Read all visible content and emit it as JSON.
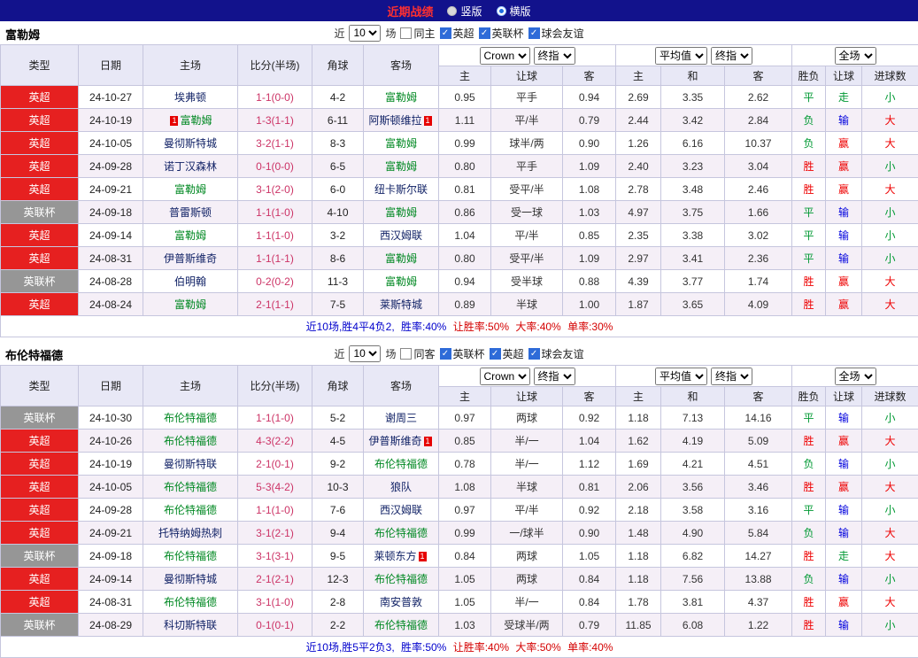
{
  "colors": {
    "topbar": "#12128c",
    "title_red": "#ff3030",
    "epl_red": "#e62020",
    "cup_gray": "#969696",
    "team_green": "#008822",
    "score_pink": "#cc3366",
    "win_red": "#ee0000",
    "lose_green": "#009933",
    "push_blue": "#0000dd"
  },
  "top_bar": {
    "title": "近期战绩",
    "vertical_label": "竖版",
    "horizontal_label": "横版"
  },
  "sections": [
    {
      "team": "富勒姆",
      "filter": {
        "prefix": "近",
        "count": "10",
        "suffix": "场",
        "checkboxes": [
          {
            "label": "同主",
            "checked": false
          },
          {
            "label": "英超",
            "checked": true
          },
          {
            "label": "英联杯",
            "checked": true
          },
          {
            "label": "球会友谊",
            "checked": true
          }
        ]
      },
      "dropdowns": {
        "odds_source": "Crown",
        "odds_time": "终指",
        "avg_source": "平均值",
        "avg_time": "终指",
        "scope": "全场"
      },
      "header": {
        "type": "类型",
        "date": "日期",
        "home": "主场",
        "score": "比分(半场)",
        "corner": "角球",
        "away": "客场",
        "odds_cols": [
          "主",
          "让球",
          "客"
        ],
        "avg_cols": [
          "主",
          "和",
          "客"
        ],
        "result_cols": [
          "胜负",
          "让球",
          "进球数"
        ]
      },
      "rows": [
        {
          "league": "英超",
          "league_class": "epl",
          "date": "24-10-27",
          "home": {
            "name": "埃弗顿",
            "main": false
          },
          "score": "1-1(0-0)",
          "corner": "4-2",
          "away": {
            "name": "富勒姆",
            "main": true
          },
          "odds": [
            "0.95",
            "平手",
            "0.94"
          ],
          "avg": [
            "2.69",
            "3.35",
            "2.62"
          ],
          "result": [
            {
              "t": "平",
              "c": "g"
            },
            {
              "t": "走",
              "c": "g"
            },
            {
              "t": "小",
              "c": "g"
            }
          ]
        },
        {
          "league": "英超",
          "league_class": "epl",
          "date": "24-10-19",
          "home": {
            "name": "富勒姆",
            "main": true,
            "card_pre": "1"
          },
          "score": "1-3(1-1)",
          "corner": "6-11",
          "away": {
            "name": "阿斯顿维拉",
            "main": false,
            "card_post": "1"
          },
          "odds": [
            "1.11",
            "平/半",
            "0.79"
          ],
          "avg": [
            "2.44",
            "3.42",
            "2.84"
          ],
          "result": [
            {
              "t": "负",
              "c": "g"
            },
            {
              "t": "输",
              "c": "b"
            },
            {
              "t": "大",
              "c": "r"
            }
          ]
        },
        {
          "league": "英超",
          "league_class": "epl",
          "date": "24-10-05",
          "home": {
            "name": "曼彻斯特城",
            "main": false
          },
          "score": "3-2(1-1)",
          "corner": "8-3",
          "away": {
            "name": "富勒姆",
            "main": true
          },
          "odds": [
            "0.99",
            "球半/两",
            "0.90"
          ],
          "avg": [
            "1.26",
            "6.16",
            "10.37"
          ],
          "result": [
            {
              "t": "负",
              "c": "g"
            },
            {
              "t": "赢",
              "c": "r"
            },
            {
              "t": "大",
              "c": "r"
            }
          ]
        },
        {
          "league": "英超",
          "league_class": "epl",
          "date": "24-09-28",
          "home": {
            "name": "诺丁汉森林",
            "main": false
          },
          "score": "0-1(0-0)",
          "corner": "6-5",
          "away": {
            "name": "富勒姆",
            "main": true
          },
          "odds": [
            "0.80",
            "平手",
            "1.09"
          ],
          "avg": [
            "2.40",
            "3.23",
            "3.04"
          ],
          "result": [
            {
              "t": "胜",
              "c": "r"
            },
            {
              "t": "赢",
              "c": "r"
            },
            {
              "t": "小",
              "c": "g"
            }
          ]
        },
        {
          "league": "英超",
          "league_class": "epl",
          "date": "24-09-21",
          "home": {
            "name": "富勒姆",
            "main": true
          },
          "score": "3-1(2-0)",
          "corner": "6-0",
          "away": {
            "name": "纽卡斯尔联",
            "main": false
          },
          "odds": [
            "0.81",
            "受平/半",
            "1.08"
          ],
          "avg": [
            "2.78",
            "3.48",
            "2.46"
          ],
          "result": [
            {
              "t": "胜",
              "c": "r"
            },
            {
              "t": "赢",
              "c": "r"
            },
            {
              "t": "大",
              "c": "r"
            }
          ]
        },
        {
          "league": "英联杯",
          "league_class": "cup",
          "date": "24-09-18",
          "home": {
            "name": "普雷斯顿",
            "main": false
          },
          "score": "1-1(1-0)",
          "corner": "4-10",
          "away": {
            "name": "富勒姆",
            "main": true
          },
          "odds": [
            "0.86",
            "受一球",
            "1.03"
          ],
          "avg": [
            "4.97",
            "3.75",
            "1.66"
          ],
          "result": [
            {
              "t": "平",
              "c": "g"
            },
            {
              "t": "输",
              "c": "b"
            },
            {
              "t": "小",
              "c": "g"
            }
          ]
        },
        {
          "league": "英超",
          "league_class": "epl",
          "date": "24-09-14",
          "home": {
            "name": "富勒姆",
            "main": true
          },
          "score": "1-1(1-0)",
          "corner": "3-2",
          "away": {
            "name": "西汉姆联",
            "main": false
          },
          "odds": [
            "1.04",
            "平/半",
            "0.85"
          ],
          "avg": [
            "2.35",
            "3.38",
            "3.02"
          ],
          "result": [
            {
              "t": "平",
              "c": "g"
            },
            {
              "t": "输",
              "c": "b"
            },
            {
              "t": "小",
              "c": "g"
            }
          ]
        },
        {
          "league": "英超",
          "league_class": "epl",
          "date": "24-08-31",
          "home": {
            "name": "伊普斯维奇",
            "main": false
          },
          "score": "1-1(1-1)",
          "corner": "8-6",
          "away": {
            "name": "富勒姆",
            "main": true
          },
          "odds": [
            "0.80",
            "受平/半",
            "1.09"
          ],
          "avg": [
            "2.97",
            "3.41",
            "2.36"
          ],
          "result": [
            {
              "t": "平",
              "c": "g"
            },
            {
              "t": "输",
              "c": "b"
            },
            {
              "t": "小",
              "c": "g"
            }
          ]
        },
        {
          "league": "英联杯",
          "league_class": "cup",
          "date": "24-08-28",
          "home": {
            "name": "伯明翰",
            "main": false
          },
          "score": "0-2(0-2)",
          "corner": "11-3",
          "away": {
            "name": "富勒姆",
            "main": true
          },
          "odds": [
            "0.94",
            "受半球",
            "0.88"
          ],
          "avg": [
            "4.39",
            "3.77",
            "1.74"
          ],
          "result": [
            {
              "t": "胜",
              "c": "r"
            },
            {
              "t": "赢",
              "c": "r"
            },
            {
              "t": "大",
              "c": "r"
            }
          ]
        },
        {
          "league": "英超",
          "league_class": "epl",
          "date": "24-08-24",
          "home": {
            "name": "富勒姆",
            "main": true
          },
          "score": "2-1(1-1)",
          "corner": "7-5",
          "away": {
            "name": "莱斯特城",
            "main": false
          },
          "odds": [
            "0.89",
            "半球",
            "1.00"
          ],
          "avg": [
            "1.87",
            "3.65",
            "4.09"
          ],
          "result": [
            {
              "t": "胜",
              "c": "r"
            },
            {
              "t": "赢",
              "c": "r"
            },
            {
              "t": "大",
              "c": "r"
            }
          ]
        }
      ],
      "summary": [
        {
          "text": "近10场,胜4平4负2, ",
          "color": "#0000cc"
        },
        {
          "text": "胜率:40% ",
          "color": "#0000cc"
        },
        {
          "text": "让胜率:50% ",
          "color": "#d40000"
        },
        {
          "text": "大率:40% ",
          "color": "#d40000"
        },
        {
          "text": "单率:30%",
          "color": "#d40000"
        }
      ]
    },
    {
      "team": "布伦特福德",
      "filter": {
        "prefix": "近",
        "count": "10",
        "suffix": "场",
        "checkboxes": [
          {
            "label": "同客",
            "checked": false
          },
          {
            "label": "英联杯",
            "checked": true
          },
          {
            "label": "英超",
            "checked": true
          },
          {
            "label": "球会友谊",
            "checked": true
          }
        ]
      },
      "dropdowns": {
        "odds_source": "Crown",
        "odds_time": "终指",
        "avg_source": "平均值",
        "avg_time": "终指",
        "scope": "全场"
      },
      "header": {
        "type": "类型",
        "date": "日期",
        "home": "主场",
        "score": "比分(半场)",
        "corner": "角球",
        "away": "客场",
        "odds_cols": [
          "主",
          "让球",
          "客"
        ],
        "avg_cols": [
          "主",
          "和",
          "客"
        ],
        "result_cols": [
          "胜负",
          "让球",
          "进球数"
        ]
      },
      "rows": [
        {
          "league": "英联杯",
          "league_class": "cup",
          "date": "24-10-30",
          "home": {
            "name": "布伦特福德",
            "main": true
          },
          "score": "1-1(1-0)",
          "corner": "5-2",
          "away": {
            "name": "谢周三",
            "main": false
          },
          "odds": [
            "0.97",
            "两球",
            "0.92"
          ],
          "avg": [
            "1.18",
            "7.13",
            "14.16"
          ],
          "result": [
            {
              "t": "平",
              "c": "g"
            },
            {
              "t": "输",
              "c": "b"
            },
            {
              "t": "小",
              "c": "g"
            }
          ]
        },
        {
          "league": "英超",
          "league_class": "epl",
          "date": "24-10-26",
          "home": {
            "name": "布伦特福德",
            "main": true
          },
          "score": "4-3(2-2)",
          "corner": "4-5",
          "away": {
            "name": "伊普斯维奇",
            "main": false,
            "card_post": "1"
          },
          "odds": [
            "0.85",
            "半/一",
            "1.04"
          ],
          "avg": [
            "1.62",
            "4.19",
            "5.09"
          ],
          "result": [
            {
              "t": "胜",
              "c": "r"
            },
            {
              "t": "赢",
              "c": "r"
            },
            {
              "t": "大",
              "c": "r"
            }
          ]
        },
        {
          "league": "英超",
          "league_class": "epl",
          "date": "24-10-19",
          "home": {
            "name": "曼彻斯特联",
            "main": false
          },
          "score": "2-1(0-1)",
          "corner": "9-2",
          "away": {
            "name": "布伦特福德",
            "main": true
          },
          "odds": [
            "0.78",
            "半/一",
            "1.12"
          ],
          "avg": [
            "1.69",
            "4.21",
            "4.51"
          ],
          "result": [
            {
              "t": "负",
              "c": "g"
            },
            {
              "t": "输",
              "c": "b"
            },
            {
              "t": "小",
              "c": "g"
            }
          ]
        },
        {
          "league": "英超",
          "league_class": "epl",
          "date": "24-10-05",
          "home": {
            "name": "布伦特福德",
            "main": true
          },
          "score": "5-3(4-2)",
          "corner": "10-3",
          "away": {
            "name": "狼队",
            "main": false
          },
          "odds": [
            "1.08",
            "半球",
            "0.81"
          ],
          "avg": [
            "2.06",
            "3.56",
            "3.46"
          ],
          "result": [
            {
              "t": "胜",
              "c": "r"
            },
            {
              "t": "赢",
              "c": "r"
            },
            {
              "t": "大",
              "c": "r"
            }
          ]
        },
        {
          "league": "英超",
          "league_class": "epl",
          "date": "24-09-28",
          "home": {
            "name": "布伦特福德",
            "main": true
          },
          "score": "1-1(1-0)",
          "corner": "7-6",
          "away": {
            "name": "西汉姆联",
            "main": false
          },
          "odds": [
            "0.97",
            "平/半",
            "0.92"
          ],
          "avg": [
            "2.18",
            "3.58",
            "3.16"
          ],
          "result": [
            {
              "t": "平",
              "c": "g"
            },
            {
              "t": "输",
              "c": "b"
            },
            {
              "t": "小",
              "c": "g"
            }
          ]
        },
        {
          "league": "英超",
          "league_class": "epl",
          "date": "24-09-21",
          "home": {
            "name": "托特纳姆热刺",
            "main": false
          },
          "score": "3-1(2-1)",
          "corner": "9-4",
          "away": {
            "name": "布伦特福德",
            "main": true
          },
          "odds": [
            "0.99",
            "一/球半",
            "0.90"
          ],
          "avg": [
            "1.48",
            "4.90",
            "5.84"
          ],
          "result": [
            {
              "t": "负",
              "c": "g"
            },
            {
              "t": "输",
              "c": "b"
            },
            {
              "t": "大",
              "c": "r"
            }
          ]
        },
        {
          "league": "英联杯",
          "league_class": "cup",
          "date": "24-09-18",
          "home": {
            "name": "布伦特福德",
            "main": true
          },
          "score": "3-1(3-1)",
          "corner": "9-5",
          "away": {
            "name": "莱顿东方",
            "main": false,
            "card_post": "1"
          },
          "odds": [
            "0.84",
            "两球",
            "1.05"
          ],
          "avg": [
            "1.18",
            "6.82",
            "14.27"
          ],
          "result": [
            {
              "t": "胜",
              "c": "r"
            },
            {
              "t": "走",
              "c": "g"
            },
            {
              "t": "大",
              "c": "r"
            }
          ]
        },
        {
          "league": "英超",
          "league_class": "epl",
          "date": "24-09-14",
          "home": {
            "name": "曼彻斯特城",
            "main": false
          },
          "score": "2-1(2-1)",
          "corner": "12-3",
          "away": {
            "name": "布伦特福德",
            "main": true
          },
          "odds": [
            "1.05",
            "两球",
            "0.84"
          ],
          "avg": [
            "1.18",
            "7.56",
            "13.88"
          ],
          "result": [
            {
              "t": "负",
              "c": "g"
            },
            {
              "t": "输",
              "c": "b"
            },
            {
              "t": "小",
              "c": "g"
            }
          ]
        },
        {
          "league": "英超",
          "league_class": "epl",
          "date": "24-08-31",
          "home": {
            "name": "布伦特福德",
            "main": true
          },
          "score": "3-1(1-0)",
          "corner": "2-8",
          "away": {
            "name": "南安普敦",
            "main": false
          },
          "odds": [
            "1.05",
            "半/一",
            "0.84"
          ],
          "avg": [
            "1.78",
            "3.81",
            "4.37"
          ],
          "result": [
            {
              "t": "胜",
              "c": "r"
            },
            {
              "t": "赢",
              "c": "r"
            },
            {
              "t": "大",
              "c": "r"
            }
          ]
        },
        {
          "league": "英联杯",
          "league_class": "cup",
          "date": "24-08-29",
          "home": {
            "name": "科切斯特联",
            "main": false
          },
          "score": "0-1(0-1)",
          "corner": "2-2",
          "away": {
            "name": "布伦特福德",
            "main": true
          },
          "odds": [
            "1.03",
            "受球半/两",
            "0.79"
          ],
          "avg": [
            "11.85",
            "6.08",
            "1.22"
          ],
          "result": [
            {
              "t": "胜",
              "c": "r"
            },
            {
              "t": "输",
              "c": "b"
            },
            {
              "t": "小",
              "c": "g"
            }
          ]
        }
      ],
      "summary": [
        {
          "text": "近10场,胜5平2负3, ",
          "color": "#0000cc"
        },
        {
          "text": "胜率:50% ",
          "color": "#0000cc"
        },
        {
          "text": "让胜率:40% ",
          "color": "#d40000"
        },
        {
          "text": "大率:50% ",
          "color": "#d40000"
        },
        {
          "text": "单率:40%",
          "color": "#d40000"
        }
      ]
    }
  ]
}
